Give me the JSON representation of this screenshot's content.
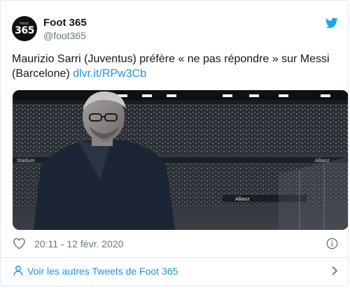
{
  "account": {
    "display_name": "Foot 365",
    "handle": "@foot365",
    "avatar_top": "foot",
    "avatar_main": "365"
  },
  "tweet": {
    "text": "Maurizio Sarri (Juventus) préfère « ne pas répondre » sur Messi (Barcelone)",
    "link": "dlvr.it/RPw3Cb"
  },
  "meta": {
    "timestamp": "20:11 - 12 févr. 2020"
  },
  "footer": {
    "more_tweets_label": "Voir les autres Tweets de Foot 365"
  },
  "media": {
    "stadium_texts": [
      "Stadium",
      "Allianz",
      "Allianz"
    ]
  },
  "icons": {
    "brand": "twitter-bird-icon",
    "like": "heart-icon",
    "info": "info-icon",
    "profile": "user-icon",
    "chevron": "chevron-right-icon"
  },
  "colors": {
    "text": "#14171a",
    "secondary": "#657786",
    "link": "#1b95e0",
    "twitter_blue": "#1da1f2",
    "border": "#e1e8ed"
  }
}
